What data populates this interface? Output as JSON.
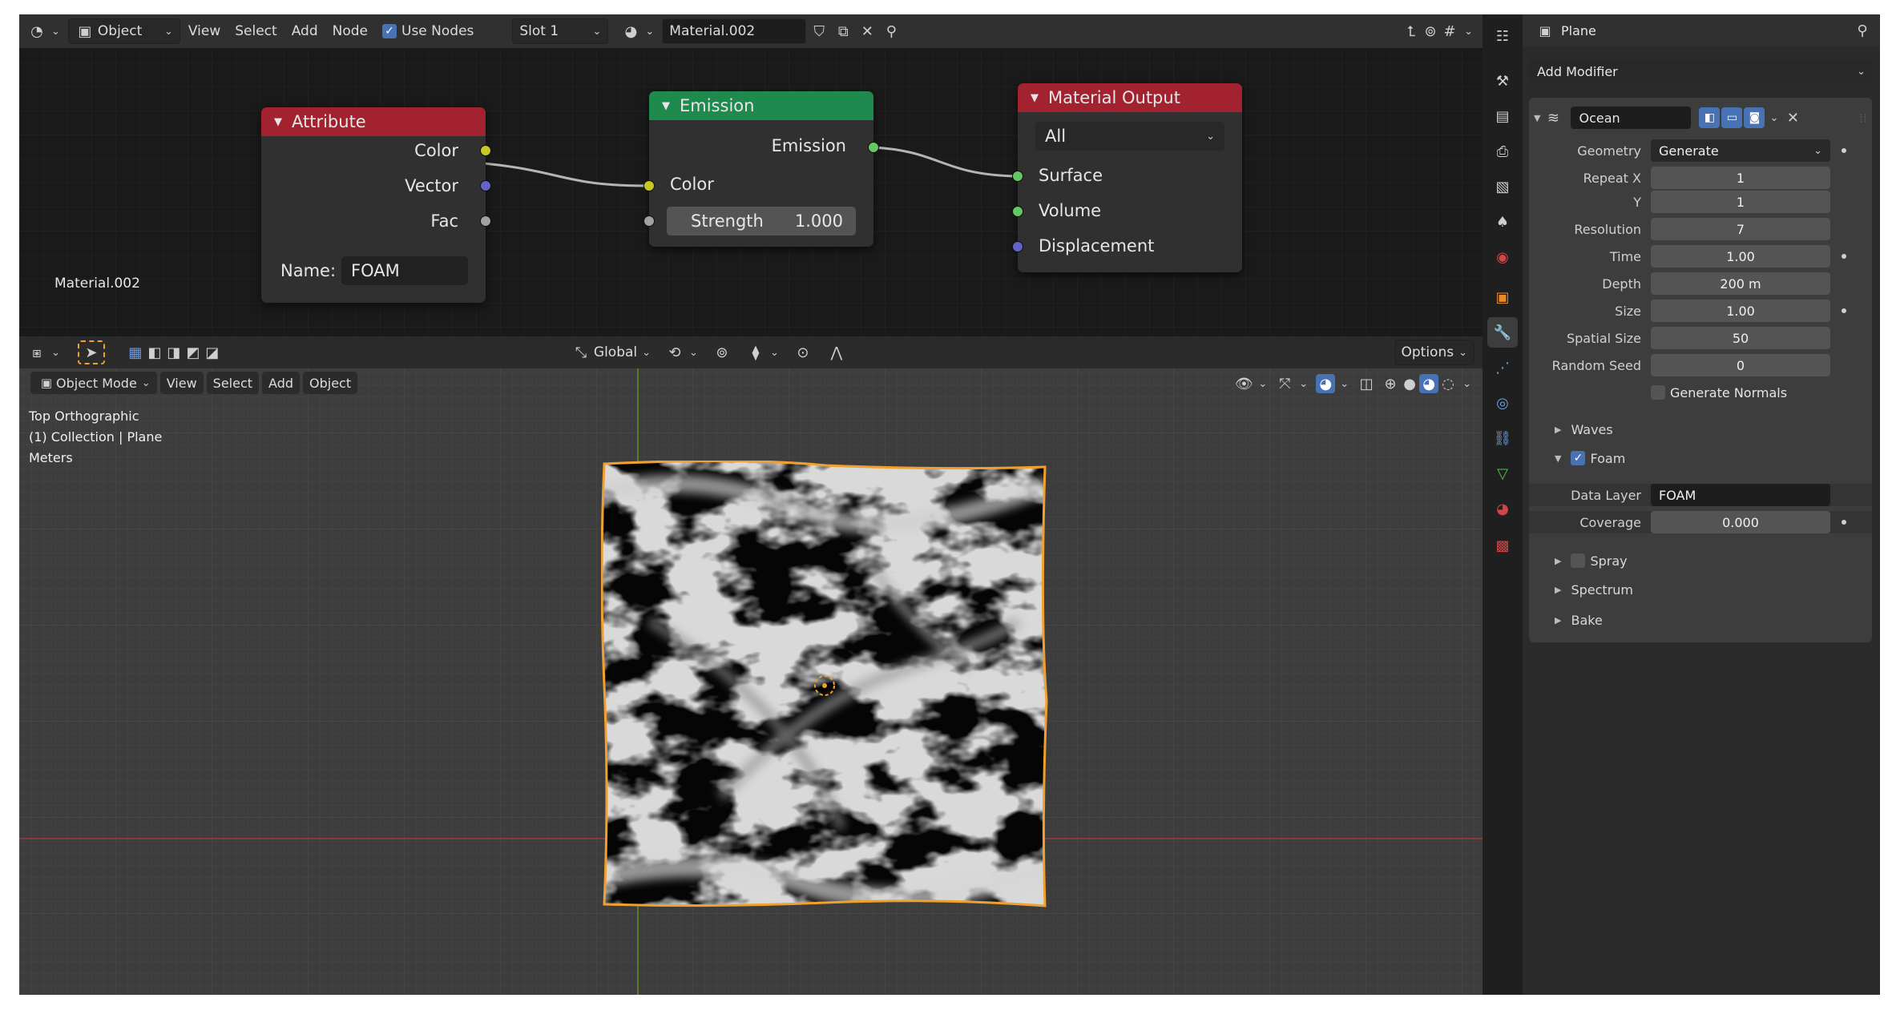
{
  "node_editor": {
    "header": {
      "object_menu": "Object",
      "menus": [
        "View",
        "Select",
        "Add",
        "Node"
      ],
      "use_nodes_label": "Use Nodes",
      "slot": "Slot 1",
      "material": "Material.002"
    },
    "material_label": "Material.002",
    "nodes": {
      "attribute": {
        "title": "Attribute",
        "color_out": "Color",
        "vector_out": "Vector",
        "fac_out": "Fac",
        "name_label": "Name:",
        "name_value": "FOAM"
      },
      "emission": {
        "title": "Emission",
        "emission_out": "Emission",
        "color_in": "Color",
        "strength_label": "Strength",
        "strength_value": "1.000"
      },
      "material_output": {
        "title": "Material Output",
        "target": "All",
        "surface_in": "Surface",
        "volume_in": "Volume",
        "displacement_in": "Displacement"
      }
    }
  },
  "viewport": {
    "transform_orientation": "Global",
    "options_label": "Options",
    "mode": "Object Mode",
    "menus": [
      "View",
      "Select",
      "Add",
      "Object"
    ],
    "overlay_lines": [
      "Top Orthographic",
      "(1) Collection | Plane",
      "Meters"
    ]
  },
  "properties": {
    "object_name": "Plane",
    "add_modifier": "Add Modifier",
    "modifier": {
      "name": "Ocean",
      "fields": [
        {
          "label": "Geometry",
          "value": "Generate",
          "kind": "enum",
          "dot": true
        },
        {
          "label": "Repeat X",
          "value": "1",
          "kind": "num",
          "dot": false
        },
        {
          "label": "Y",
          "value": "1",
          "kind": "num",
          "dot": false
        },
        {
          "label": "Resolution",
          "value": "7",
          "kind": "num",
          "dot": false
        },
        {
          "label": "Time",
          "value": "1.00",
          "kind": "num",
          "dot": true
        },
        {
          "label": "Depth",
          "value": "200 m",
          "kind": "num",
          "dot": false
        },
        {
          "label": "Size",
          "value": "1.00",
          "kind": "num",
          "dot": true
        },
        {
          "label": "Spatial Size",
          "value": "50",
          "kind": "num",
          "dot": false
        },
        {
          "label": "Random Seed",
          "value": "0",
          "kind": "num",
          "dot": false
        }
      ],
      "generate_normals": "Generate Normals",
      "waves": "Waves",
      "foam": "Foam",
      "data_layer_label": "Data Layer",
      "data_layer_value": "FOAM",
      "coverage_label": "Coverage",
      "coverage_value": "0.000",
      "spray": "Spray",
      "spectrum": "Spectrum",
      "bake": "Bake"
    }
  },
  "colors": {
    "attribute_header": "#a3222f",
    "emission_header": "#1f8a4d",
    "output_header": "#a3222f",
    "selection_outline": "#f0a030",
    "accent": "#4772b3"
  }
}
